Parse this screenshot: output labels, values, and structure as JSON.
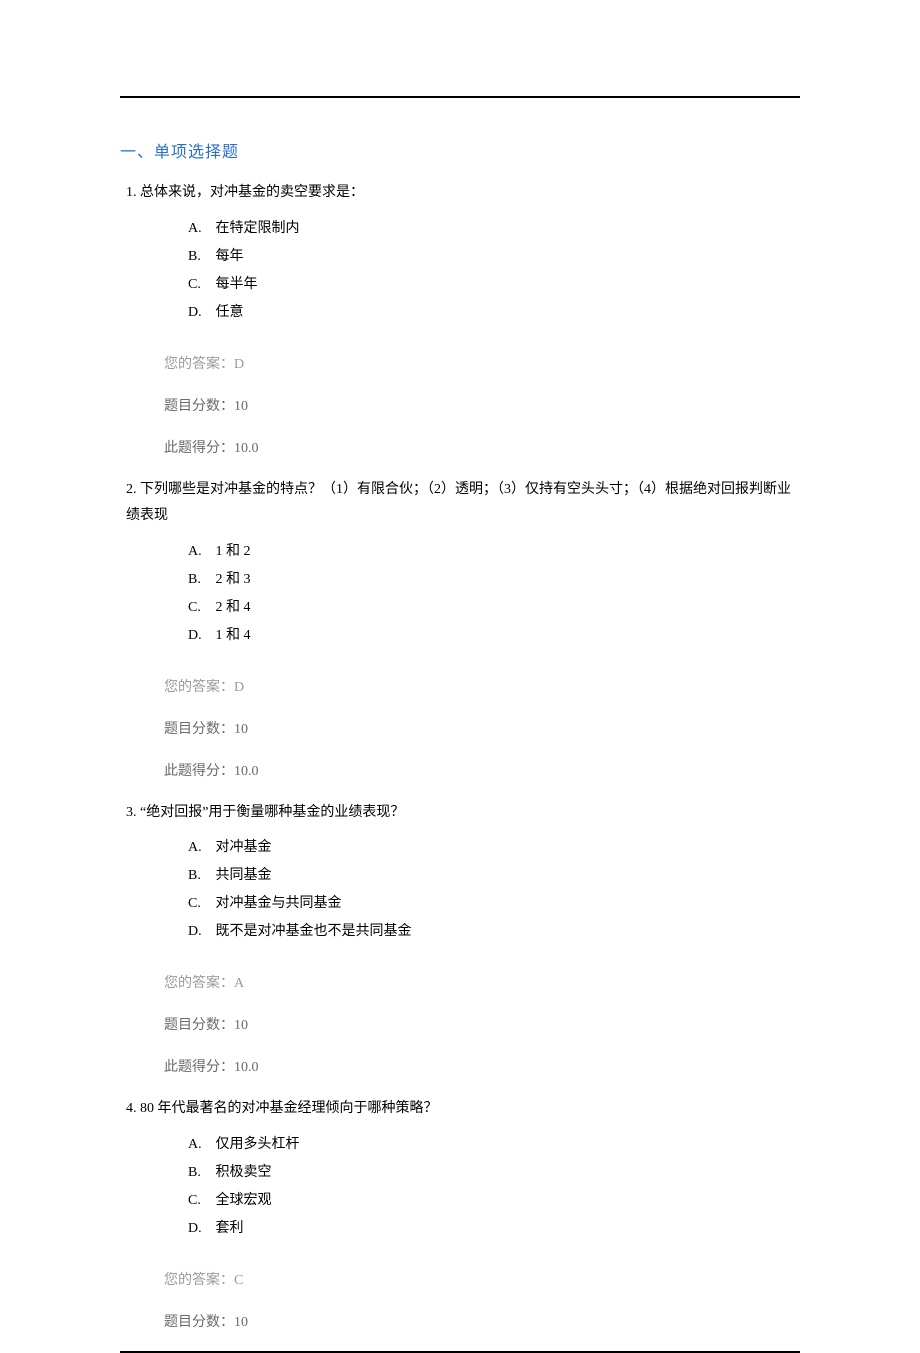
{
  "section_title": "一、单项选择题",
  "labels": {
    "your_answer": "您的答案：",
    "question_points": "题目分数：",
    "earned_points": "此题得分："
  },
  "questions": [
    {
      "number": "1.",
      "stem": "总体来说，对冲基金的卖空要求是：",
      "options": [
        {
          "letter": "A.",
          "text": "在特定限制内"
        },
        {
          "letter": "B.",
          "text": "每年"
        },
        {
          "letter": "C.",
          "text": "每半年"
        },
        {
          "letter": "D.",
          "text": "任意"
        }
      ],
      "your_answer": "D",
      "question_points": "10",
      "earned_points": "10.0"
    },
    {
      "number": "2.",
      "stem": "下列哪些是对冲基金的特点？（1）有限合伙；（2）透明；（3）仅持有空头头寸；（4）根据绝对回报判断业绩表现",
      "options": [
        {
          "letter": "A.",
          "text": "1 和 2"
        },
        {
          "letter": "B.",
          "text": "2 和 3"
        },
        {
          "letter": "C.",
          "text": "2 和 4"
        },
        {
          "letter": "D.",
          "text": "1 和 4"
        }
      ],
      "your_answer": "D",
      "question_points": "10",
      "earned_points": "10.0"
    },
    {
      "number": "3.",
      "stem": "“绝对回报”用于衡量哪种基金的业绩表现？",
      "options": [
        {
          "letter": "A.",
          "text": "对冲基金"
        },
        {
          "letter": "B.",
          "text": "共同基金"
        },
        {
          "letter": "C.",
          "text": "对冲基金与共同基金"
        },
        {
          "letter": "D.",
          "text": "既不是对冲基金也不是共同基金"
        }
      ],
      "your_answer": "A",
      "question_points": "10",
      "earned_points": "10.0"
    },
    {
      "number": "4.",
      "stem": "80 年代最著名的对冲基金经理倾向于哪种策略？",
      "options": [
        {
          "letter": "A.",
          "text": "仅用多头杠杆"
        },
        {
          "letter": "B.",
          "text": "积极卖空"
        },
        {
          "letter": "C.",
          "text": "全球宏观"
        },
        {
          "letter": "D.",
          "text": "套利"
        }
      ],
      "your_answer": "C",
      "question_points": "10",
      "earned_points": ""
    }
  ]
}
